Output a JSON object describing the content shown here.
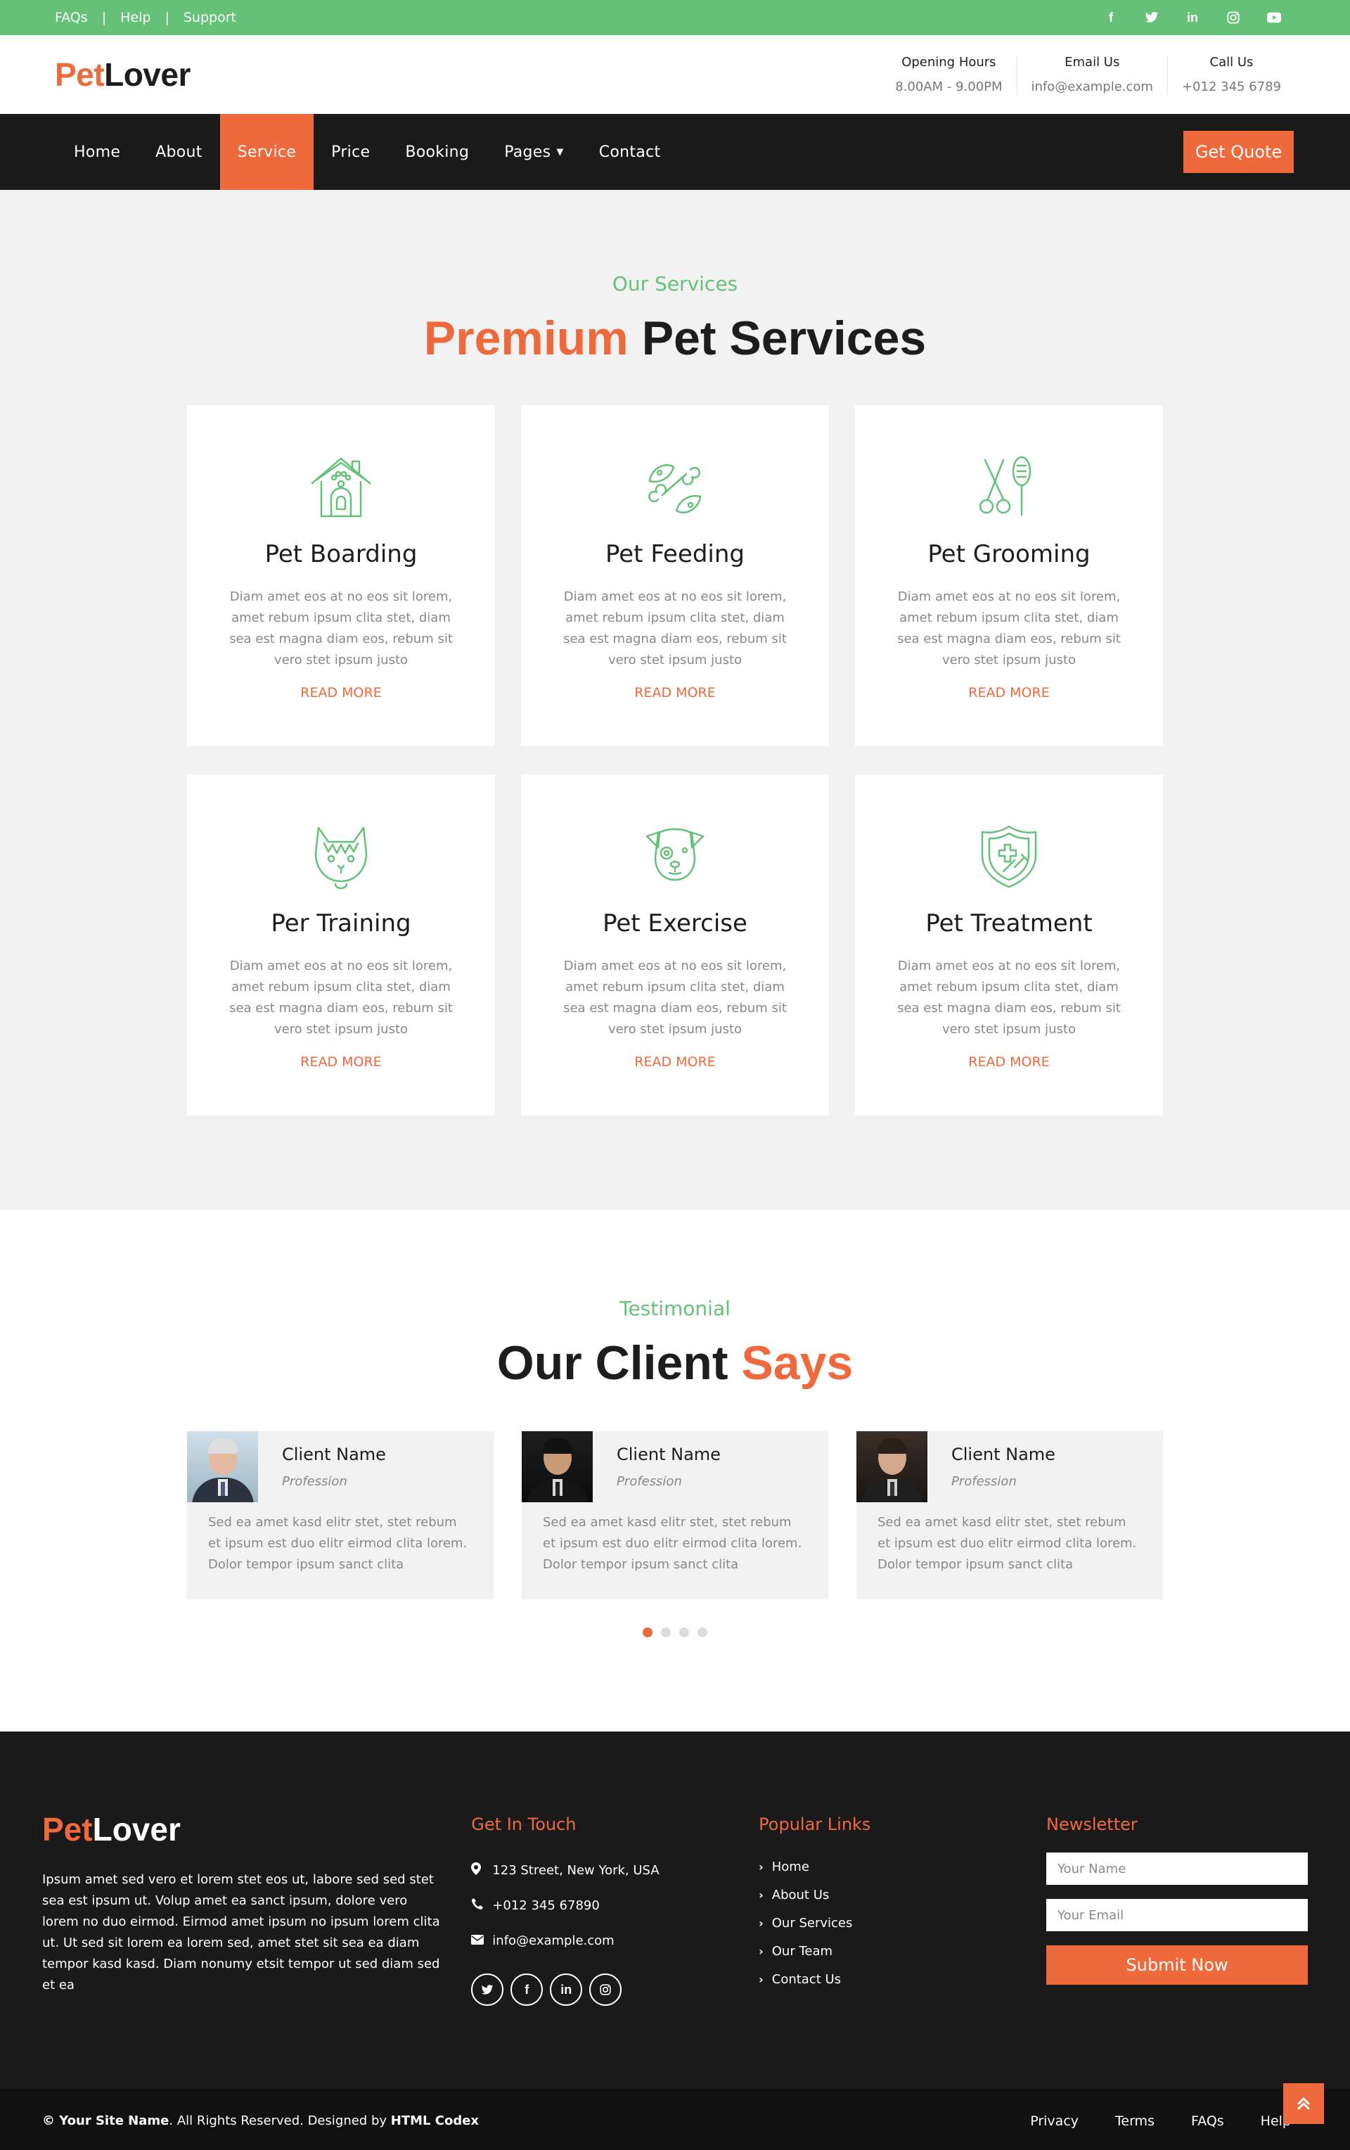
{
  "topbar": {
    "links": [
      "FAQs",
      "Help",
      "Support"
    ],
    "social_icons": [
      "facebook-icon",
      "twitter-icon",
      "linkedin-icon",
      "instagram-icon",
      "youtube-icon"
    ]
  },
  "brand": {
    "part1": "Pet",
    "part2": "Lover"
  },
  "header_info": [
    {
      "title": "Opening Hours",
      "value": "8.00AM - 9.00PM"
    },
    {
      "title": "Email Us",
      "value": "info@example.com"
    },
    {
      "title": "Call Us",
      "value": "+012 345 6789"
    }
  ],
  "nav": {
    "items": [
      "Home",
      "About",
      "Service",
      "Price",
      "Booking",
      "Pages",
      "Contact"
    ],
    "active": "Service",
    "quote_label": "Get Quote"
  },
  "services": {
    "subtitle": "Our Services",
    "title_accent": "Premium",
    "title_rest": "Pet Services",
    "cards": [
      {
        "icon": "house-icon",
        "title": "Pet Boarding",
        "desc": "Diam amet eos at no eos sit lorem, amet rebum ipsum clita stet, diam sea est magna diam eos, rebum sit vero stet ipsum justo",
        "more": "READ MORE"
      },
      {
        "icon": "food-icon",
        "title": "Pet Feeding",
        "desc": "Diam amet eos at no eos sit lorem, amet rebum ipsum clita stet, diam sea est magna diam eos, rebum sit vero stet ipsum justo",
        "more": "READ MORE"
      },
      {
        "icon": "grooming-icon",
        "title": "Pet Grooming",
        "desc": "Diam amet eos at no eos sit lorem, amet rebum ipsum clita stet, diam sea est magna diam eos, rebum sit vero stet ipsum justo",
        "more": "READ MORE"
      },
      {
        "icon": "cat-icon",
        "title": "Per Training",
        "desc": "Diam amet eos at no eos sit lorem, amet rebum ipsum clita stet, diam sea est magna diam eos, rebum sit vero stet ipsum justo",
        "more": "READ MORE"
      },
      {
        "icon": "dog-icon",
        "title": "Pet Exercise",
        "desc": "Diam amet eos at no eos sit lorem, amet rebum ipsum clita stet, diam sea est magna diam eos, rebum sit vero stet ipsum justo",
        "more": "READ MORE"
      },
      {
        "icon": "vet-shield-icon",
        "title": "Pet Treatment",
        "desc": "Diam amet eos at no eos sit lorem, amet rebum ipsum clita stet, diam sea est magna diam eos, rebum sit vero stet ipsum justo",
        "more": "READ MORE"
      }
    ]
  },
  "testimonial": {
    "subtitle": "Testimonial",
    "title_rest": "Our Client",
    "title_accent": "Says",
    "clients": [
      {
        "name": "Client Name",
        "profession": "Profession",
        "text": "Sed ea amet kasd elitr stet, stet rebum et ipsum est duo elitr eirmod clita lorem. Dolor tempor ipsum sanct clita"
      },
      {
        "name": "Client Name",
        "profession": "Profession",
        "text": "Sed ea amet kasd elitr stet, stet rebum et ipsum est duo elitr eirmod clita lorem. Dolor tempor ipsum sanct clita"
      },
      {
        "name": "Client Name",
        "profession": "Profession",
        "text": "Sed ea amet kasd elitr stet, stet rebum et ipsum est duo elitr eirmod clita lorem. Dolor tempor ipsum sanct clita"
      }
    ],
    "dots_count": 4,
    "active_dot": 1
  },
  "footer": {
    "about": "Ipsum amet sed vero et lorem stet eos ut, labore sed sed stet sea est ipsum ut. Volup amet ea sanct ipsum, dolore vero lorem no duo eirmod. Eirmod amet ipsum no ipsum lorem clita ut. Ut sed sit lorem ea lorem sed, amet stet sit sea ea diam tempor kasd kasd. Diam nonumy etsit tempor ut sed diam sed et ea",
    "get_in_touch": {
      "heading": "Get In Touch",
      "address": "123 Street, New York, USA",
      "phone": "+012 345 67890",
      "email": "info@example.com"
    },
    "popular_links": {
      "heading": "Popular Links",
      "items": [
        "Home",
        "About Us",
        "Our Services",
        "Our Team",
        "Contact Us"
      ]
    },
    "newsletter": {
      "heading": "Newsletter",
      "name_placeholder": "Your Name",
      "email_placeholder": "Your Email",
      "submit_label": "Submit Now"
    },
    "social_icons": [
      "twitter-icon",
      "facebook-icon",
      "linkedin-icon",
      "instagram-icon"
    ]
  },
  "bottom": {
    "copyright_site": "© Your Site Name",
    "copyright_mid": ". All Rights Reserved. Designed by ",
    "copyright_designer": "HTML Codex",
    "links": [
      "Privacy",
      "Terms",
      "FAQs",
      "Help"
    ]
  },
  "colors": {
    "primary": "#EE6A3D",
    "secondary": "#65C178",
    "dark": "#1a1a1a"
  }
}
